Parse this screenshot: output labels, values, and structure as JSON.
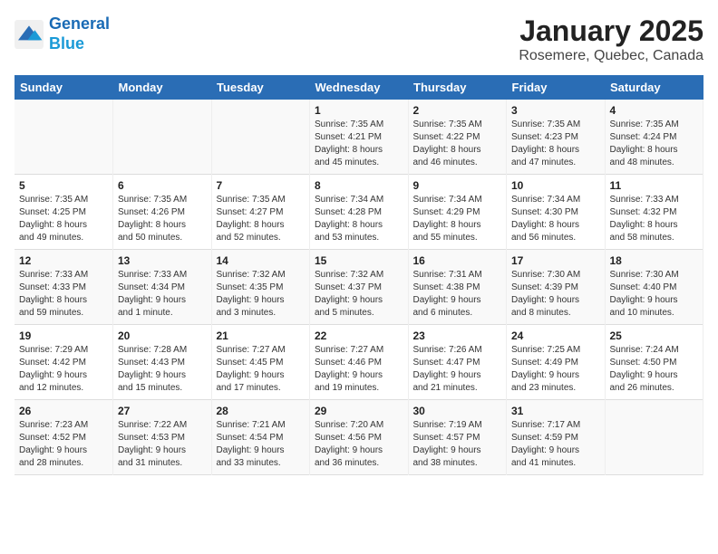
{
  "logo": {
    "line1": "General",
    "line2": "Blue"
  },
  "title": "January 2025",
  "subtitle": "Rosemere, Quebec, Canada",
  "days_of_week": [
    "Sunday",
    "Monday",
    "Tuesday",
    "Wednesday",
    "Thursday",
    "Friday",
    "Saturday"
  ],
  "weeks": [
    [
      {
        "day": "",
        "text": ""
      },
      {
        "day": "",
        "text": ""
      },
      {
        "day": "",
        "text": ""
      },
      {
        "day": "1",
        "text": "Sunrise: 7:35 AM\nSunset: 4:21 PM\nDaylight: 8 hours\nand 45 minutes."
      },
      {
        "day": "2",
        "text": "Sunrise: 7:35 AM\nSunset: 4:22 PM\nDaylight: 8 hours\nand 46 minutes."
      },
      {
        "day": "3",
        "text": "Sunrise: 7:35 AM\nSunset: 4:23 PM\nDaylight: 8 hours\nand 47 minutes."
      },
      {
        "day": "4",
        "text": "Sunrise: 7:35 AM\nSunset: 4:24 PM\nDaylight: 8 hours\nand 48 minutes."
      }
    ],
    [
      {
        "day": "5",
        "text": "Sunrise: 7:35 AM\nSunset: 4:25 PM\nDaylight: 8 hours\nand 49 minutes."
      },
      {
        "day": "6",
        "text": "Sunrise: 7:35 AM\nSunset: 4:26 PM\nDaylight: 8 hours\nand 50 minutes."
      },
      {
        "day": "7",
        "text": "Sunrise: 7:35 AM\nSunset: 4:27 PM\nDaylight: 8 hours\nand 52 minutes."
      },
      {
        "day": "8",
        "text": "Sunrise: 7:34 AM\nSunset: 4:28 PM\nDaylight: 8 hours\nand 53 minutes."
      },
      {
        "day": "9",
        "text": "Sunrise: 7:34 AM\nSunset: 4:29 PM\nDaylight: 8 hours\nand 55 minutes."
      },
      {
        "day": "10",
        "text": "Sunrise: 7:34 AM\nSunset: 4:30 PM\nDaylight: 8 hours\nand 56 minutes."
      },
      {
        "day": "11",
        "text": "Sunrise: 7:33 AM\nSunset: 4:32 PM\nDaylight: 8 hours\nand 58 minutes."
      }
    ],
    [
      {
        "day": "12",
        "text": "Sunrise: 7:33 AM\nSunset: 4:33 PM\nDaylight: 8 hours\nand 59 minutes."
      },
      {
        "day": "13",
        "text": "Sunrise: 7:33 AM\nSunset: 4:34 PM\nDaylight: 9 hours\nand 1 minute."
      },
      {
        "day": "14",
        "text": "Sunrise: 7:32 AM\nSunset: 4:35 PM\nDaylight: 9 hours\nand 3 minutes."
      },
      {
        "day": "15",
        "text": "Sunrise: 7:32 AM\nSunset: 4:37 PM\nDaylight: 9 hours\nand 5 minutes."
      },
      {
        "day": "16",
        "text": "Sunrise: 7:31 AM\nSunset: 4:38 PM\nDaylight: 9 hours\nand 6 minutes."
      },
      {
        "day": "17",
        "text": "Sunrise: 7:30 AM\nSunset: 4:39 PM\nDaylight: 9 hours\nand 8 minutes."
      },
      {
        "day": "18",
        "text": "Sunrise: 7:30 AM\nSunset: 4:40 PM\nDaylight: 9 hours\nand 10 minutes."
      }
    ],
    [
      {
        "day": "19",
        "text": "Sunrise: 7:29 AM\nSunset: 4:42 PM\nDaylight: 9 hours\nand 12 minutes."
      },
      {
        "day": "20",
        "text": "Sunrise: 7:28 AM\nSunset: 4:43 PM\nDaylight: 9 hours\nand 15 minutes."
      },
      {
        "day": "21",
        "text": "Sunrise: 7:27 AM\nSunset: 4:45 PM\nDaylight: 9 hours\nand 17 minutes."
      },
      {
        "day": "22",
        "text": "Sunrise: 7:27 AM\nSunset: 4:46 PM\nDaylight: 9 hours\nand 19 minutes."
      },
      {
        "day": "23",
        "text": "Sunrise: 7:26 AM\nSunset: 4:47 PM\nDaylight: 9 hours\nand 21 minutes."
      },
      {
        "day": "24",
        "text": "Sunrise: 7:25 AM\nSunset: 4:49 PM\nDaylight: 9 hours\nand 23 minutes."
      },
      {
        "day": "25",
        "text": "Sunrise: 7:24 AM\nSunset: 4:50 PM\nDaylight: 9 hours\nand 26 minutes."
      }
    ],
    [
      {
        "day": "26",
        "text": "Sunrise: 7:23 AM\nSunset: 4:52 PM\nDaylight: 9 hours\nand 28 minutes."
      },
      {
        "day": "27",
        "text": "Sunrise: 7:22 AM\nSunset: 4:53 PM\nDaylight: 9 hours\nand 31 minutes."
      },
      {
        "day": "28",
        "text": "Sunrise: 7:21 AM\nSunset: 4:54 PM\nDaylight: 9 hours\nand 33 minutes."
      },
      {
        "day": "29",
        "text": "Sunrise: 7:20 AM\nSunset: 4:56 PM\nDaylight: 9 hours\nand 36 minutes."
      },
      {
        "day": "30",
        "text": "Sunrise: 7:19 AM\nSunset: 4:57 PM\nDaylight: 9 hours\nand 38 minutes."
      },
      {
        "day": "31",
        "text": "Sunrise: 7:17 AM\nSunset: 4:59 PM\nDaylight: 9 hours\nand 41 minutes."
      },
      {
        "day": "",
        "text": ""
      }
    ]
  ]
}
